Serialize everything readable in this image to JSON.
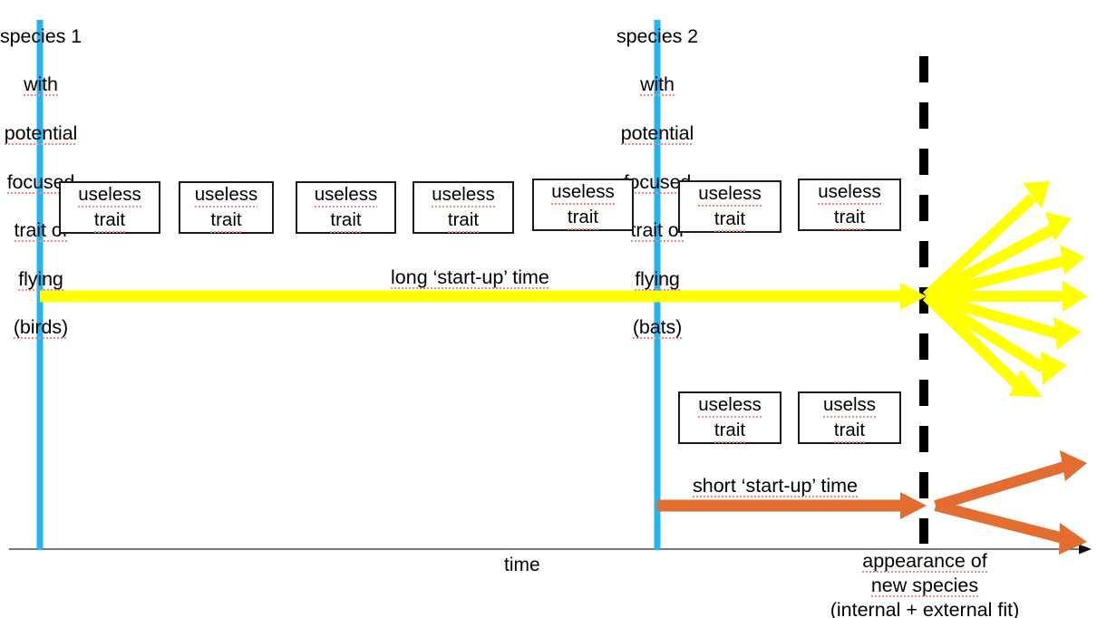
{
  "diagram": {
    "title_axis_label": "time",
    "colors": {
      "species_line": "#24b4f2",
      "long_path": "#ffff00",
      "short_path": "#e36c30",
      "event_line": "#000000",
      "box_border": "#1b1b1b",
      "spellcheck_underline": "#f08a8a"
    },
    "species": [
      {
        "id": "species-1",
        "lines": [
          "species 1",
          "with",
          "potential",
          "focused",
          "trait of",
          "flying",
          "(birds)"
        ],
        "misspelled": [
          false,
          true,
          true,
          true,
          true,
          true,
          true
        ]
      },
      {
        "id": "species-2",
        "lines": [
          "species 2",
          "with",
          "potential",
          "focused",
          "trait of",
          "flying",
          "(bats)"
        ],
        "misspelled": [
          false,
          true,
          true,
          true,
          true,
          true,
          true
        ]
      }
    ],
    "trait_boxes_top": [
      {
        "line1": "useless",
        "line2": "trait"
      },
      {
        "line1": "useless",
        "line2": "trait"
      },
      {
        "line1": "useless",
        "line2": "trait"
      },
      {
        "line1": "useless",
        "line2": "trait"
      },
      {
        "line1": "useless",
        "line2": "trait"
      },
      {
        "line1": "useless",
        "line2": "trait"
      },
      {
        "line1": "useless",
        "line2": "trait"
      }
    ],
    "trait_boxes_bottom": [
      {
        "line1": "useless",
        "line2": "trait"
      },
      {
        "line1": "uselss",
        "line2": "trait"
      }
    ],
    "long_arrow_label": "long ‘start-up’ time",
    "short_arrow_label": "short ‘start-up’ time",
    "event_caption": {
      "line1": "appearance of",
      "line2": "new species",
      "line3": "(internal + external fit)"
    },
    "fan_counts": {
      "long_outcomes": 7,
      "short_outcomes": 2
    }
  }
}
